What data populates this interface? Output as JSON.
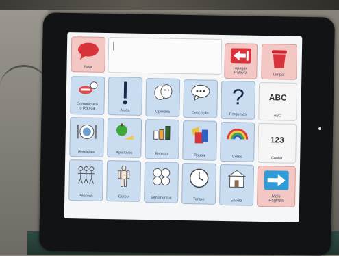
{
  "aac_board": {
    "top": {
      "falar": "Falar",
      "apagar": "Apagar\nPalavra",
      "limpar": "Limpar"
    },
    "rows": [
      [
        {
          "label": "Comunicaçã\no Rápida",
          "icon": "mouth-speech-icon"
        },
        {
          "label": "Ajuda",
          "icon": "exclamation-icon"
        },
        {
          "label": "Opiniões",
          "icon": "faces-icon"
        },
        {
          "label": "Descrição",
          "icon": "speech-bubble-icon"
        },
        {
          "label": "Perguntas",
          "icon": "question-mark-icon"
        },
        {
          "label": "ABC",
          "icon_text": "ABC"
        }
      ],
      [
        {
          "label": "Refeições",
          "icon": "meal-icon"
        },
        {
          "label": "Aperitivos",
          "icon": "apple-cheese-icon"
        },
        {
          "label": "Bebidas",
          "icon": "drinks-icon"
        },
        {
          "label": "Roupa",
          "icon": "clothes-icon"
        },
        {
          "label": "Cores",
          "icon": "rainbow-icon"
        },
        {
          "label": "Contar",
          "icon_text": "123"
        }
      ],
      [
        {
          "label": "Pessoas",
          "icon": "people-icon"
        },
        {
          "label": "Corpo",
          "icon": "body-icon"
        },
        {
          "label": "Sentimentos",
          "icon": "feelings-faces-icon"
        },
        {
          "label": "Tempo",
          "icon": "clock-icon"
        },
        {
          "label": "Escola",
          "icon": "school-icon"
        },
        {
          "label": "Mais\nPaginas",
          "icon": "arrow-right-icon"
        }
      ]
    ]
  },
  "colors": {
    "tile_blue": "#c9dcf0",
    "tile_red": "#f3c7c4",
    "accent_red": "#d8333b",
    "arrow_blue": "#2e9bd6"
  }
}
